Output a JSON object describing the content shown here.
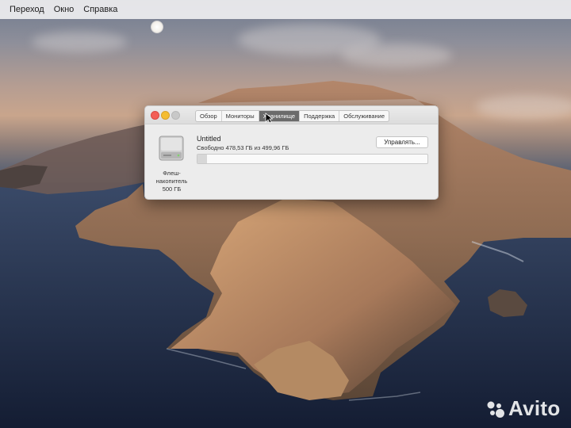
{
  "menubar": {
    "items": [
      "Переход",
      "Окно",
      "Справка"
    ]
  },
  "window": {
    "tabs": [
      {
        "label": "Обзор",
        "active": false
      },
      {
        "label": "Мониторы",
        "active": false
      },
      {
        "label": "Хранилище",
        "active": true
      },
      {
        "label": "Поддержка",
        "active": false
      },
      {
        "label": "Обслуживание",
        "active": false
      }
    ],
    "drive": {
      "caption_line1": "Флеш-",
      "caption_line2": "накопитель",
      "caption_line3": "500 ГБ",
      "icon": "hard-drive-icon"
    },
    "volume": {
      "name": "Untitled",
      "free_text": "Свободно 478,53 ГБ из 499,96 ГБ",
      "used_fraction": 0.04
    },
    "manage_label": "Управлять..."
  },
  "watermark": {
    "text": "Avito"
  },
  "colors": {
    "close": "#f35f57",
    "minimize": "#f4bd32",
    "zoom": "#c8c8c8",
    "active_tab": "#6b6b6b"
  }
}
